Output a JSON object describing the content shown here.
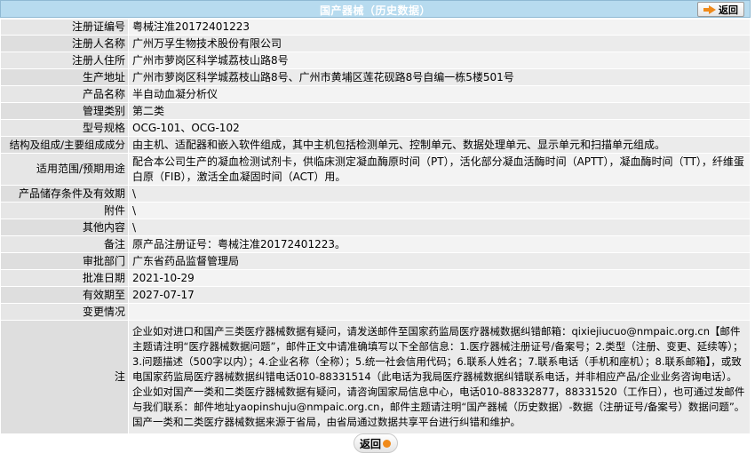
{
  "header": {
    "title": "国产器械（历史数据）",
    "back_label": "返回"
  },
  "rows": [
    {
      "label": "注册证编号",
      "value": "粤械注准20172401223"
    },
    {
      "label": "注册人名称",
      "value": "广州万孚生物技术股份有限公司"
    },
    {
      "label": "注册人住所",
      "value": "广州市萝岗区科学城荔枝山路8号"
    },
    {
      "label": "生产地址",
      "value": "广州市萝岗区科学城荔枝山路8号、广州市黄埔区莲花砚路8号自编一栋5楼501号"
    },
    {
      "label": "产品名称",
      "value": "半自动血凝分析仪"
    },
    {
      "label": "管理类别",
      "value": "第二类"
    },
    {
      "label": "型号规格",
      "value": "OCG-101、OCG-102"
    },
    {
      "label": "结构及组成/主要组成成分",
      "value": "由主机、适配器和嵌入软件组成，其中主机包括检测单元、控制单元、数据处理单元、显示单元和扫描单元组成。"
    },
    {
      "label": "适用范围/预期用途",
      "value": "配合本公司生产的凝血检测试剂卡，供临床测定凝血酶原时间（PT），活化部分凝血活酶时间（APTT），凝血酶时间（TT），纤维蛋白原（FIB），激活全血凝固时间（ACT）用。"
    },
    {
      "label": "产品储存条件及有效期",
      "value": "\\"
    },
    {
      "label": "附件",
      "value": "\\"
    },
    {
      "label": "其他内容",
      "value": "\\"
    },
    {
      "label": "备注",
      "value": "原产品注册证号：粤械注准20172401223。"
    },
    {
      "label": "审批部门",
      "value": "广东省药品监督管理局"
    },
    {
      "label": "批准日期",
      "value": "2021-10-29"
    },
    {
      "label": "有效期至",
      "value": "2027-07-17"
    },
    {
      "label": "变更情况",
      "value": ""
    }
  ],
  "note": {
    "label": "注",
    "text": "企业如对进口和国产三类医疗器械数据有疑问，请发送邮件至国家药监局医疗器械数据纠错邮箱：qixiejiucuo@nmpaic.org.cn【邮件主题请注明“医疗器械数据问题”，邮件正文中请准确填写以下全部信息：1.医疗器械注册证号/备案号；2.类型（注册、变更、延续等）；3.问题描述（500字以内）；4.企业名称（全称）；5.统一社会信用代码；6.联系人姓名；7.联系电话（手机和座机）；8.联系邮箱】，或致电国家药监局医疗器械数据纠错电话010-88331514（此电话为我局医疗器械数据纠错联系电话，并非相应产品/企业业务咨询电话）。企业如对国产一类和二类医疗器械数据有疑问，请咨询国家局信息中心，电话010-88332877，88331520（工作日），也可通过发邮件与我们联系：邮件地址yaopinshuju@nmpaic.org.cn，邮件主题请注明“国产器械（历史数据）-数据（注册证号/备案号）数据问题”。国产一类和二类医疗器械数据来源于省局，由省局通过数据共享平台进行纠错和维护。"
  },
  "footer": {
    "back_label": "返回"
  }
}
